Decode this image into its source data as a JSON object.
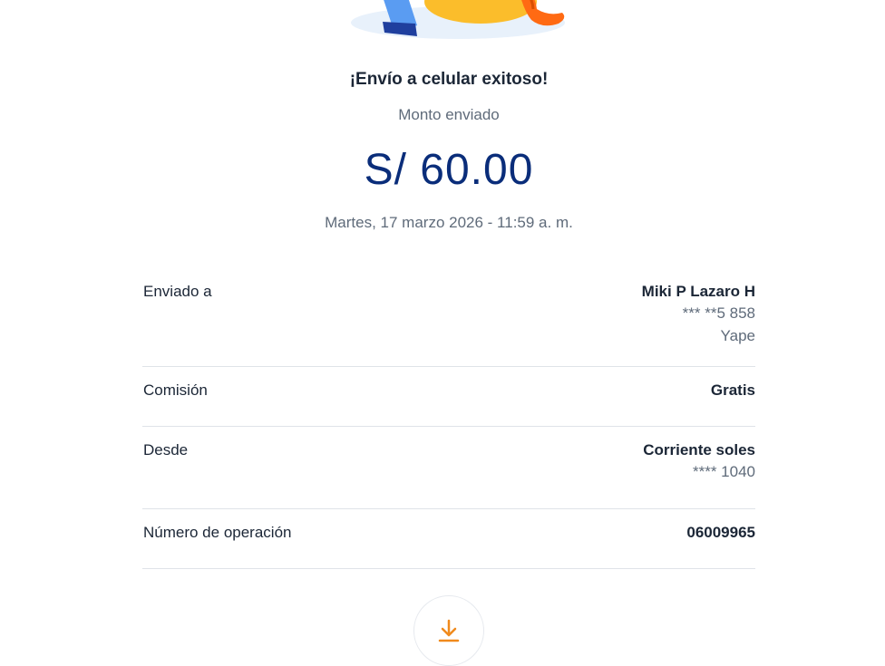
{
  "receipt": {
    "title": "¡Envío a celular exitoso!",
    "amount_label": "Monto enviado",
    "amount": "S/ 60.00",
    "datetime": "Martes, 17 marzo 2026 - 11:59 a. m."
  },
  "details": {
    "sent_to": {
      "label": "Enviado a",
      "name": "Miki P Lazaro H",
      "phone": "*** **5 858",
      "app": "Yape"
    },
    "fee": {
      "label": "Comisión",
      "value": "Gratis"
    },
    "from": {
      "label": "Desde",
      "account": "Corriente soles",
      "number": "**** 1040"
    },
    "operation": {
      "label": "Número de operación",
      "value": "06009965"
    }
  },
  "actions": {
    "download_icon": "download-icon"
  },
  "colors": {
    "amount": "#0a2d7a",
    "accent": "#f08a1c",
    "text_secondary": "#5f6b7a"
  }
}
